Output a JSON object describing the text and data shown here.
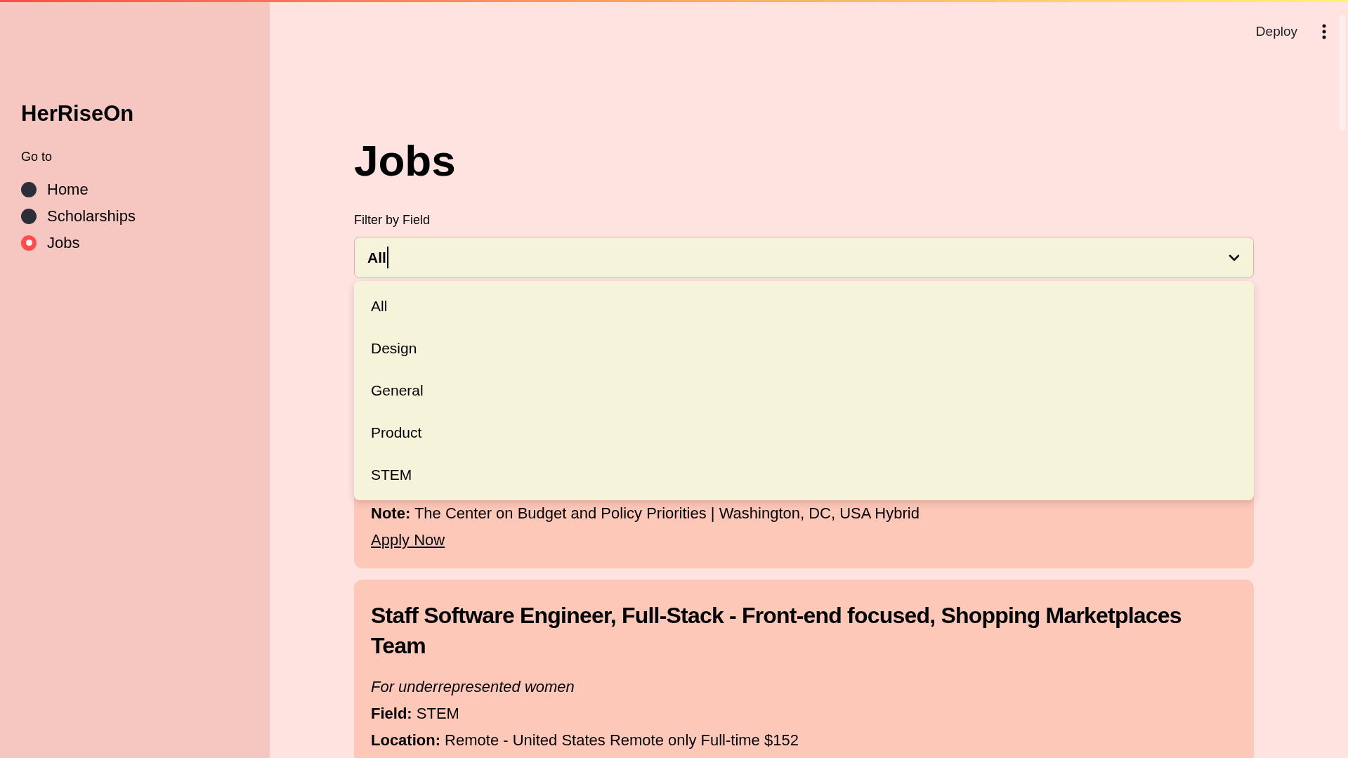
{
  "sidebar": {
    "app_title": "HerRiseOn",
    "nav_label": "Go to",
    "nav_items": [
      {
        "label": "Home",
        "selected": false
      },
      {
        "label": "Scholarships",
        "selected": false
      },
      {
        "label": "Jobs",
        "selected": true
      }
    ]
  },
  "header": {
    "deploy": "Deploy"
  },
  "page_title": "Jobs",
  "filter": {
    "label": "Filter by Field",
    "value": "All",
    "expanded": true,
    "options": [
      "All",
      "Design",
      "General",
      "Product",
      "STEM"
    ]
  },
  "jobs": [
    {
      "details": [
        {
          "label": "Note:",
          "value": "The Center on Budget and Policy Priorities | Washington, DC, USA Hybrid"
        }
      ],
      "link": "Apply Now"
    },
    {
      "title": "Staff Software Engineer, Full-Stack - Front-end focused, Shopping Marketplaces Team",
      "subtitle": "For underrepresented women",
      "details": [
        {
          "label": "Field:",
          "value": "STEM"
        },
        {
          "label": "Location:",
          "value": "Remote - United States Remote only Full-time $152"
        }
      ]
    }
  ]
}
